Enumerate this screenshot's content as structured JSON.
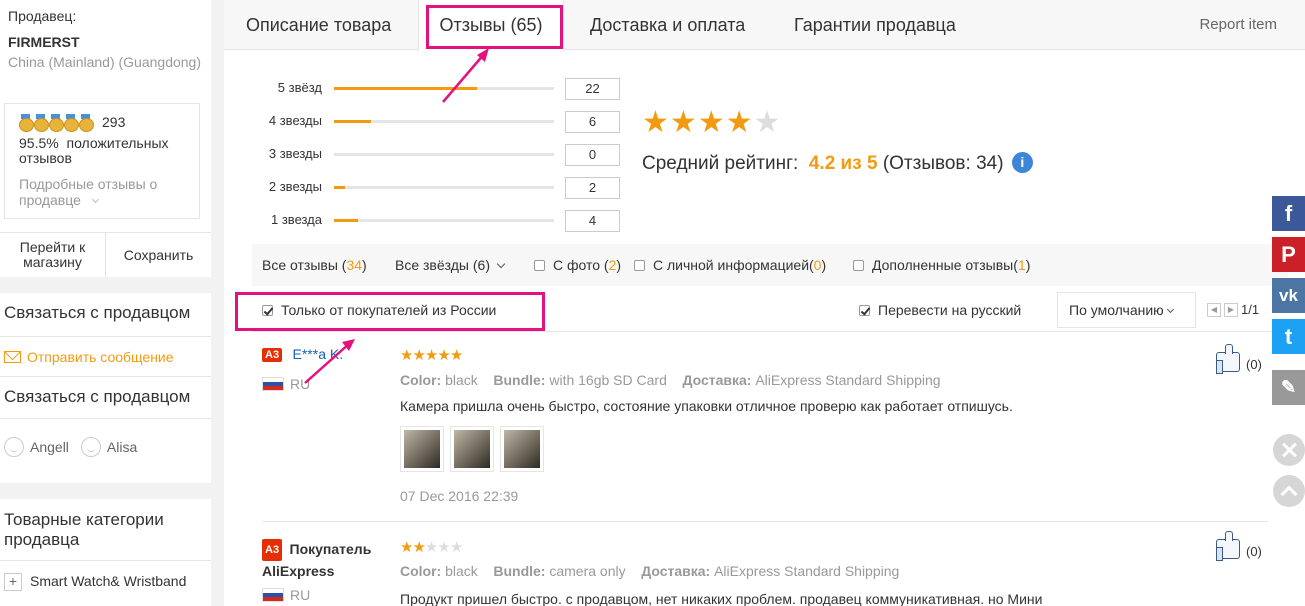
{
  "seller": {
    "label": "Продавец:",
    "name": "FIRMERST",
    "location": "China (Mainland) (Guangdong)",
    "score": "293",
    "positive_pct": "95.5%",
    "positive_label": "положительных отзывов",
    "details_link": "Подробные отзывы о продавце",
    "go_to_store": "Перейти к магазину",
    "save": "Сохранить"
  },
  "contact": {
    "title": "Связаться с продавцом",
    "send_message": "Отправить сообщение",
    "title2": "Связаться с продавцом",
    "agents": [
      "Angell",
      "Alisa"
    ]
  },
  "categories": {
    "title": "Товарные категории продавца",
    "items": [
      "Smart Watch& Wristband"
    ]
  },
  "tabs": {
    "items": [
      "Описание товара",
      "Отзывы (65)",
      "Доставка и оплата",
      "Гарантии продавца"
    ],
    "active_index": 1,
    "report": "Report item"
  },
  "histogram": {
    "rows": [
      {
        "label": "5 звёзд",
        "count": "22",
        "fraction": 0.65
      },
      {
        "label": "4 звезды",
        "count": "6",
        "fraction": 0.17
      },
      {
        "label": "3 звезды",
        "count": "0",
        "fraction": 0.0
      },
      {
        "label": "2 звезды",
        "count": "2",
        "fraction": 0.05
      },
      {
        "label": "1 звезда",
        "count": "4",
        "fraction": 0.11
      }
    ]
  },
  "rating": {
    "stars_filled": 4,
    "stars_total": 5,
    "label": "Средний рейтинг:",
    "value": "4.2 из 5",
    "count_text": "(Отзывов: 34)"
  },
  "filters": {
    "all_label": "Все отзывы (",
    "all_count": "34",
    "all_close": ")",
    "stars_select": "Все звёзды (6)",
    "with_photo_label": "С фото (",
    "with_photo_count": "2",
    "with_photo_close": ")",
    "personal_label": "С личной информацией(",
    "personal_count": "0",
    "personal_close": ")",
    "additional_label": "Дополненные отзывы(",
    "additional_count": "1",
    "additional_close": ")"
  },
  "options": {
    "only_russia": "Только от покупателей из России",
    "only_russia_checked": true,
    "translate": "Перевести на русский",
    "translate_checked": true,
    "sort": "По умолчанию",
    "page": "1/1"
  },
  "reviews": [
    {
      "badge": "A3",
      "user": "E***a K.",
      "country": "RU",
      "stars": 5,
      "color_label": "Color:",
      "color": "black",
      "bundle_label": "Bundle:",
      "bundle": "with 16gb SD Card",
      "delivery_label": "Доставка:",
      "delivery": "AliExpress Standard Shipping",
      "text": "Камера пришла очень быстро, состояние упаковки отличное проверю как работает отпишусь.",
      "photos": 3,
      "date": "07 Dec 2016 22:39",
      "likes": "(0)"
    },
    {
      "badge": "A3",
      "user": "Покупатель AliExpress",
      "country": "RU",
      "stars": 2,
      "color_label": "Color:",
      "color": "black",
      "bundle_label": "Bundle:",
      "bundle": "camera only",
      "delivery_label": "Доставка:",
      "delivery": "AliExpress Standard Shipping",
      "text": "Продукт пришел быстро. с продавцом, нет никаких проблем. продавец коммуникативная. но Мини",
      "likes": "(0)"
    }
  ],
  "social": [
    {
      "icon": "facebook-icon",
      "glyph": "f",
      "color": "#3b5998"
    },
    {
      "icon": "pinterest-icon",
      "glyph": "P",
      "color": "#cb2027"
    },
    {
      "icon": "vk-icon",
      "glyph": "vk",
      "color": "#4c75a3"
    },
    {
      "icon": "twitter-icon",
      "glyph": "t",
      "color": "#1da1f2"
    },
    {
      "icon": "edit-icon",
      "glyph": "✎",
      "color": "#999999"
    }
  ],
  "colors": {
    "accent": "#f29b11",
    "highlight": "#e3127e",
    "link": "#1a5fb4"
  }
}
